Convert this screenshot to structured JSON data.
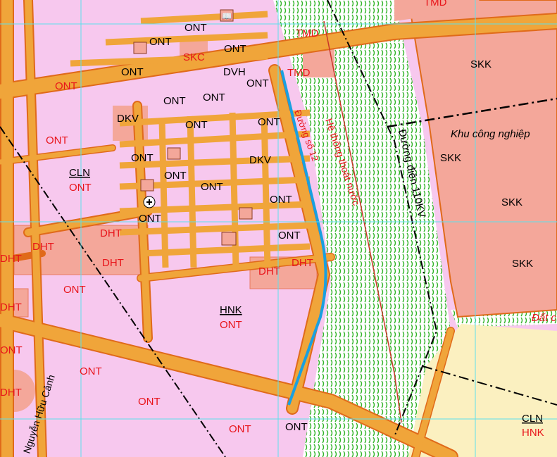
{
  "labels": {
    "ont": "ONT",
    "dht": "DHT",
    "dvh": "DVH",
    "dkv": "DKV",
    "tmd": "TMD",
    "skk": "SKK",
    "skc": "SKC",
    "cln": "CLN",
    "hnk": "HNK",
    "kcn": "Khu công nghiệp",
    "drain": "Hệ thống thoát nước",
    "powerline": "Đường điện 110KV",
    "road12": "Đường số 12",
    "street": "Nguyễn Hữu Cảnh",
    "dat": "Đất c"
  },
  "colors": {
    "residential": "#f7c8ee",
    "road": "#f0a53a",
    "roadEdge": "#e06a1a",
    "industrial": "#f4a79a",
    "agri": "#fbf0c0",
    "green": "#2fb32a",
    "blueRiver": "#1aa0e0",
    "grid": "#5ce0ec"
  },
  "icons": [
    "book-icon",
    "hospital-icon"
  ]
}
